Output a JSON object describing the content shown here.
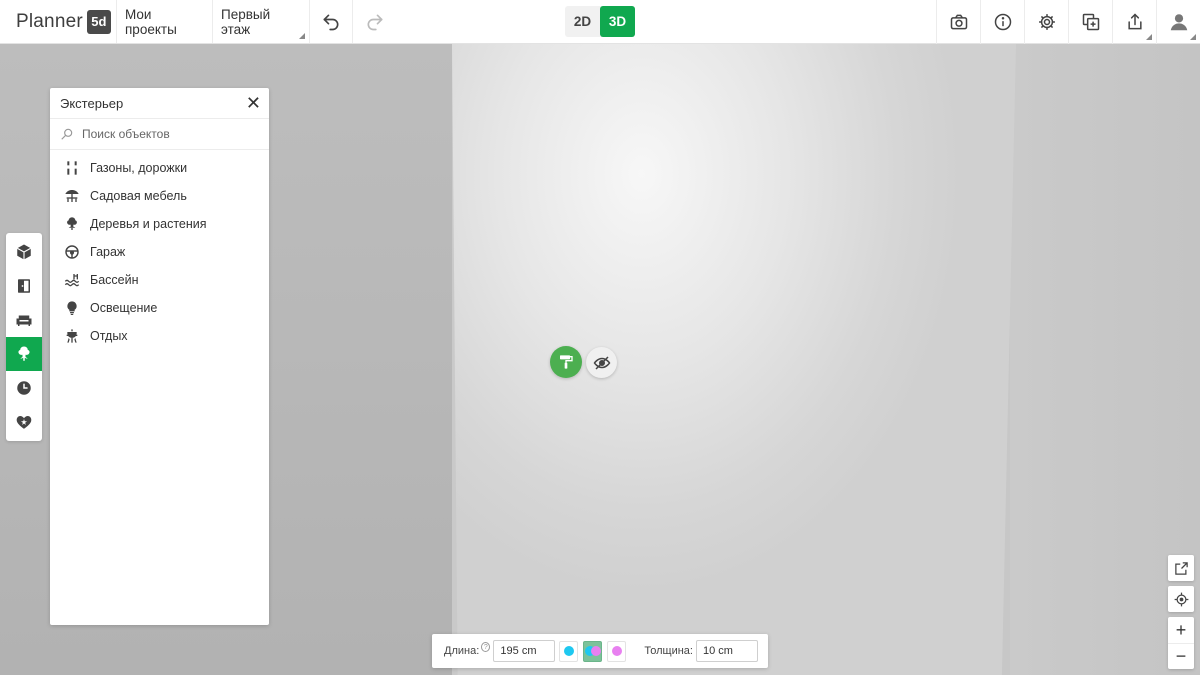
{
  "app": {
    "logo_text": "Planner",
    "logo_badge": "5d"
  },
  "topbar": {
    "projects_label": "Мои проекты",
    "floor_label": "Первый этаж",
    "mode_2d": "2D",
    "mode_3d": "3D",
    "active_mode": "3D",
    "left_icons": [
      "undo-icon",
      "redo-icon"
    ],
    "right_icons": [
      "camera-icon",
      "info-icon",
      "gear-icon",
      "add-copy-icon",
      "share-icon",
      "user-avatar-icon"
    ]
  },
  "leftbar": {
    "items": [
      {
        "icon": "cube-icon",
        "active": false
      },
      {
        "icon": "door-icon",
        "active": false
      },
      {
        "icon": "sofa-icon",
        "active": false
      },
      {
        "icon": "tree-icon",
        "active": true
      },
      {
        "icon": "clock-icon",
        "active": false
      },
      {
        "icon": "heart-icon",
        "active": false
      }
    ]
  },
  "panel": {
    "title": "Экстерьер",
    "search_placeholder": "Поиск объектов",
    "categories": [
      {
        "label": "Газоны, дорожки",
        "icon": "path-icon"
      },
      {
        "label": "Садовая мебель",
        "icon": "umbrella-table-icon"
      },
      {
        "label": "Деревья и растения",
        "icon": "tree-icon"
      },
      {
        "label": "Гараж",
        "icon": "steering-wheel-icon"
      },
      {
        "label": "Бассейн",
        "icon": "pool-icon"
      },
      {
        "label": "Освещение",
        "icon": "bulb-icon"
      },
      {
        "label": "Отдых",
        "icon": "grill-icon"
      }
    ]
  },
  "wall_actions": {
    "paint_icon": "paint-roller-icon",
    "hide_icon": "eye-off-icon"
  },
  "props": {
    "length_label": "Длина:",
    "length_value": "195 cm",
    "help": "?",
    "thickness_label": "Толщина:",
    "thickness_value": "10 cm",
    "colors": {
      "left": "#1ec8f0",
      "right": "#e880f0",
      "accent": "#10a84f"
    }
  },
  "view_controls": {
    "zoom_in": "+",
    "zoom_out": "−"
  }
}
